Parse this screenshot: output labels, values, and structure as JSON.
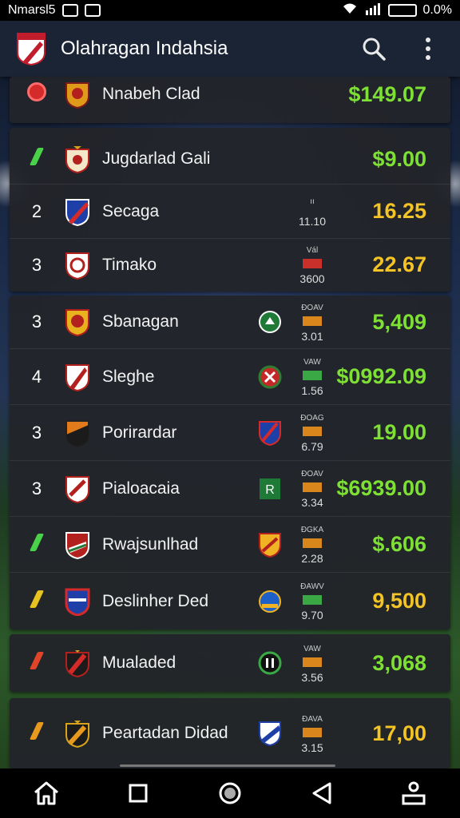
{
  "status_bar": {
    "left_text": "Nmarsl5",
    "right_text": "0.0%"
  },
  "app_bar": {
    "title": "Olahragan Indahsia"
  },
  "rows": [
    {
      "rank": "",
      "marker": "dot",
      "name": "Nnabeh Clad",
      "opp_tag": "",
      "opp_val": "",
      "value": "$149.07",
      "value_color": "#7ee034"
    },
    {
      "rank": "",
      "marker": "slash",
      "marker_color": "#4ad14a",
      "name": "Jugdarlad Gali",
      "opp_tag": "",
      "opp_val": "",
      "value": "$9.00",
      "value_color": "#7ee034"
    },
    {
      "rank": "2",
      "name": "Secaga",
      "opp_tag": "ıı",
      "opp_val": "11.10",
      "value": "16.25",
      "value_color": "#f4c324"
    },
    {
      "rank": "3",
      "name": "Timako",
      "opp_tag": "Vál",
      "opp_val": "3600",
      "value": "22.67",
      "value_color": "#f4c324"
    },
    {
      "rank": "3",
      "name": "Sbanagan",
      "opp_tag": "ĐOAV",
      "opp_val": "3.01",
      "value": "5,409",
      "value_color": "#7ee034"
    },
    {
      "rank": "4",
      "name": "Sleghe",
      "opp_tag": "VAW",
      "opp_val": "1.56",
      "value": "$0992.09",
      "value_color": "#7ee034"
    },
    {
      "rank": "3",
      "name": "Porirardar",
      "opp_tag": "ĐOAG",
      "opp_val": "6.79",
      "value": "19.00",
      "value_color": "#7ee034"
    },
    {
      "rank": "3",
      "name": "Pialoacaia",
      "opp_tag": "ĐOAV",
      "opp_val": "3.34",
      "value": "$6939.00",
      "value_color": "#7ee034"
    },
    {
      "rank": "",
      "marker": "slash",
      "marker_color": "#4ad14a",
      "name": "Rwajsunlhad",
      "opp_tag": "ĐGKA",
      "opp_val": "2.28",
      "value": "$.606",
      "value_color": "#7ee034"
    },
    {
      "rank": "",
      "marker": "slash",
      "marker_color": "#e8c21f",
      "name": "Deslinher Ded",
      "opp_tag": "ĐAWV",
      "opp_val": "9.70",
      "value": "9,500",
      "value_color": "#f4c324"
    },
    {
      "rank": "",
      "marker": "slash",
      "marker_color": "#e0452a",
      "name": "Mualaded",
      "opp_tag": "VAW",
      "opp_val": "3.56",
      "value": "3,068",
      "value_color": "#7ee034"
    },
    {
      "rank": "",
      "marker": "slash",
      "marker_color": "#e89a1f",
      "name": "Peartadan Didad",
      "opp_tag": "ĐAVA",
      "opp_val": "3.15",
      "value": "17,00",
      "value_color": "#f4c324"
    }
  ]
}
